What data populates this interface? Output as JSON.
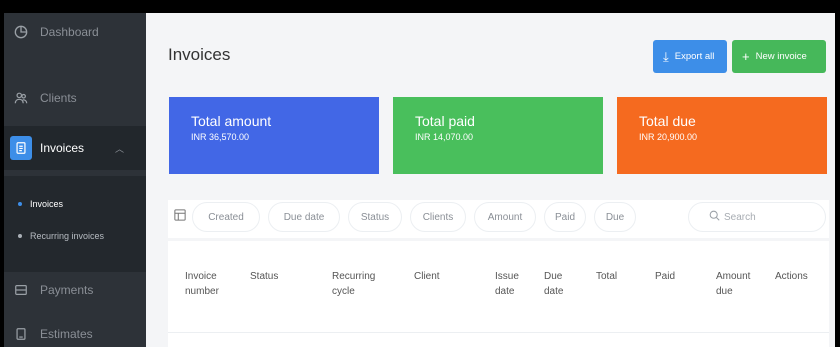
{
  "sidebar": {
    "items": [
      {
        "label": "Dashboard",
        "icon": "pie-chart-icon"
      },
      {
        "label": "Clients",
        "icon": "users-icon"
      },
      {
        "label": "Invoices",
        "icon": "invoice-icon"
      },
      {
        "label": "Payments",
        "icon": "card-icon"
      },
      {
        "label": "Estimates",
        "icon": "estimate-icon"
      }
    ],
    "submenu": [
      {
        "label": "Invoices"
      },
      {
        "label": "Recurring invoices"
      }
    ],
    "colors": {
      "bg": "#2d3238",
      "accent": "#3d8ee8"
    }
  },
  "header": {
    "title": "Invoices",
    "export_label": "Export all",
    "new_label": "New invoice"
  },
  "summary": {
    "amount": {
      "title": "Total amount",
      "value": "INR 36,570.00",
      "color": "#4267e6"
    },
    "paid": {
      "title": "Total paid",
      "value": "INR 14,070.00",
      "color": "#49bf5c"
    },
    "due": {
      "title": "Total due",
      "value": "INR 20,900.00",
      "color": "#f56a1f"
    }
  },
  "filters": {
    "chips": [
      "Created",
      "Due date",
      "Status",
      "Clients",
      "Amount",
      "Paid",
      "Due"
    ],
    "search_placeholder": "Search"
  },
  "table": {
    "columns": [
      [
        "Invoice",
        "number"
      ],
      [
        "Status",
        ""
      ],
      [
        "Recurring",
        "cycle"
      ],
      [
        "Client",
        ""
      ],
      [
        "Issue",
        "date"
      ],
      [
        "Due",
        "date"
      ],
      [
        "Total",
        ""
      ],
      [
        "Paid",
        ""
      ],
      [
        "Amount",
        "due"
      ],
      [
        "Actions",
        ""
      ]
    ]
  }
}
